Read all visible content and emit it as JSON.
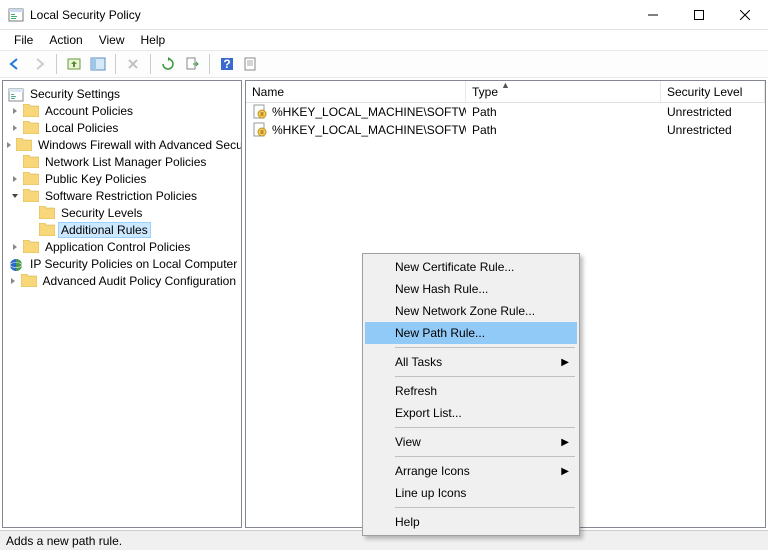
{
  "window": {
    "title": "Local Security Policy"
  },
  "menubar": [
    "File",
    "Action",
    "View",
    "Help"
  ],
  "tree": {
    "root": "Security Settings",
    "items": [
      {
        "label": "Account Policies",
        "indent": 1,
        "arrow": ">"
      },
      {
        "label": "Local Policies",
        "indent": 1,
        "arrow": ">"
      },
      {
        "label": "Windows Firewall with Advanced Security",
        "indent": 1,
        "arrow": ">"
      },
      {
        "label": "Network List Manager Policies",
        "indent": 1,
        "arrow": ""
      },
      {
        "label": "Public Key Policies",
        "indent": 1,
        "arrow": ">"
      },
      {
        "label": "Software Restriction Policies",
        "indent": 1,
        "arrow": "v"
      },
      {
        "label": "Security Levels",
        "indent": 2,
        "arrow": ""
      },
      {
        "label": "Additional Rules",
        "indent": 2,
        "arrow": "",
        "selected": true
      },
      {
        "label": "Application Control Policies",
        "indent": 1,
        "arrow": ">"
      },
      {
        "label": "IP Security Policies on Local Computer",
        "indent": 1,
        "arrow": "",
        "special": "ipsec"
      },
      {
        "label": "Advanced Audit Policy Configuration",
        "indent": 1,
        "arrow": ">"
      }
    ]
  },
  "list": {
    "columns": {
      "name": "Name",
      "type": "Type",
      "security": "Security Level"
    },
    "rows": [
      {
        "name": "%HKEY_LOCAL_MACHINE\\SOFTW...",
        "type": "Path",
        "security": "Unrestricted"
      },
      {
        "name": "%HKEY_LOCAL_MACHINE\\SOFTW...",
        "type": "Path",
        "security": "Unrestricted"
      }
    ]
  },
  "context_menu": [
    {
      "label": "New Certificate Rule...",
      "type": "item"
    },
    {
      "label": "New Hash Rule...",
      "type": "item"
    },
    {
      "label": "New Network Zone Rule...",
      "type": "item"
    },
    {
      "label": "New Path Rule...",
      "type": "item",
      "highlight": true
    },
    {
      "type": "sep"
    },
    {
      "label": "All Tasks",
      "type": "item",
      "submenu": true
    },
    {
      "type": "sep"
    },
    {
      "label": "Refresh",
      "type": "item"
    },
    {
      "label": "Export List...",
      "type": "item"
    },
    {
      "type": "sep"
    },
    {
      "label": "View",
      "type": "item",
      "submenu": true
    },
    {
      "type": "sep"
    },
    {
      "label": "Arrange Icons",
      "type": "item",
      "submenu": true
    },
    {
      "label": "Line up Icons",
      "type": "item"
    },
    {
      "type": "sep"
    },
    {
      "label": "Help",
      "type": "item"
    }
  ],
  "statusbar": {
    "text": "Adds a new path rule."
  }
}
